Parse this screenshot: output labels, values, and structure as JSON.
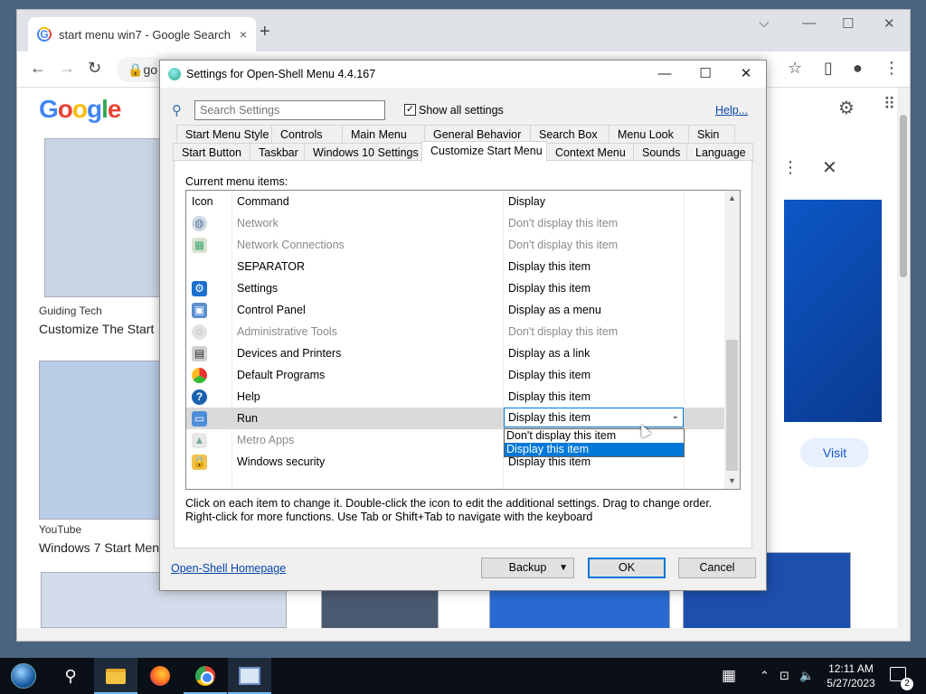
{
  "browser": {
    "tab_title": "start menu win7 - Google Search",
    "tab_close": "×",
    "new_tab": "+",
    "address_text": "go",
    "results": [
      {
        "source": "Guiding Tech",
        "title": "Customize The Start"
      },
      {
        "source": "YouTube",
        "title": "Windows 7 Start Men"
      }
    ],
    "visit_label": "Visit",
    "google_letters": [
      "G",
      "o",
      "o",
      "g",
      "l",
      "e"
    ]
  },
  "dialog": {
    "title": "Settings for Open-Shell Menu 4.4.167",
    "search_placeholder": "Search Settings",
    "show_all_label": "Show all settings",
    "show_all_checked": "✓",
    "help_label": "Help...",
    "tabs_row1": [
      "Start Menu Style",
      "Controls",
      "Main Menu",
      "General Behavior",
      "Search Box",
      "Menu Look",
      "Skin"
    ],
    "tabs_row2": [
      "Start Button",
      "Taskbar",
      "Windows 10 Settings",
      "Customize Start Menu",
      "Context Menu",
      "Sounds",
      "Language"
    ],
    "active_tab": "Customize Start Menu",
    "current_items_label": "Current menu items:",
    "columns": {
      "icon": "Icon",
      "command": "Command",
      "display": "Display"
    },
    "rows": [
      {
        "icon": "network-icon",
        "glyph": "◍",
        "command": "Network",
        "display": "Don't display this item",
        "dim": true
      },
      {
        "icon": "network-connections-icon",
        "glyph": "▦",
        "command": "Network Connections",
        "display": "Don't display this item",
        "dim": true
      },
      {
        "icon": "",
        "glyph": "",
        "command": "SEPARATOR",
        "display": "Display this item",
        "dim": false
      },
      {
        "icon": "settings-gear-icon",
        "glyph": "⚙",
        "command": "Settings",
        "display": "Display this item",
        "dim": false
      },
      {
        "icon": "control-panel-icon",
        "glyph": "▣",
        "command": "Control Panel",
        "display": "Display as a menu",
        "dim": false
      },
      {
        "icon": "administrative-tools-icon",
        "glyph": "◌",
        "command": "Administrative Tools",
        "display": "Don't display this item",
        "dim": true
      },
      {
        "icon": "devices-printers-icon",
        "glyph": "▤",
        "command": "Devices and Printers",
        "display": "Display as a link",
        "dim": false
      },
      {
        "icon": "default-programs-icon",
        "glyph": "",
        "command": "Default Programs",
        "display": "Display this item",
        "dim": false
      },
      {
        "icon": "help-icon",
        "glyph": "?",
        "command": "Help",
        "display": "Display this item",
        "dim": false
      },
      {
        "icon": "run-icon",
        "glyph": "▭",
        "command": "Run",
        "display": "Display this item",
        "dim": false
      },
      {
        "icon": "metro-apps-icon",
        "glyph": "▲",
        "command": "Metro Apps",
        "display": "",
        "dim": true
      },
      {
        "icon": "lock-icon",
        "glyph": "🔒",
        "command": "Windows security",
        "display": "Display this item",
        "dim": false
      }
    ],
    "combo_value": "Display this item",
    "dropdown_options": [
      "Don't display this item",
      "Display this item"
    ],
    "info_line1": "Click on each item to change it. Double-click the icon to edit the additional settings. Drag to change order.",
    "info_line2": "Right-click for more functions. Use Tab or Shift+Tab to navigate with the keyboard",
    "homepage_label": "Open-Shell Homepage",
    "backup_label": "Backup",
    "ok_label": "OK",
    "cancel_label": "Cancel"
  },
  "taskbar": {
    "time": "12:11 AM",
    "date": "5/27/2023",
    "notification_count": "2"
  },
  "colors": {
    "accent": "#0078d7",
    "link": "#0645ad",
    "taskbar": "#0b0f17"
  }
}
